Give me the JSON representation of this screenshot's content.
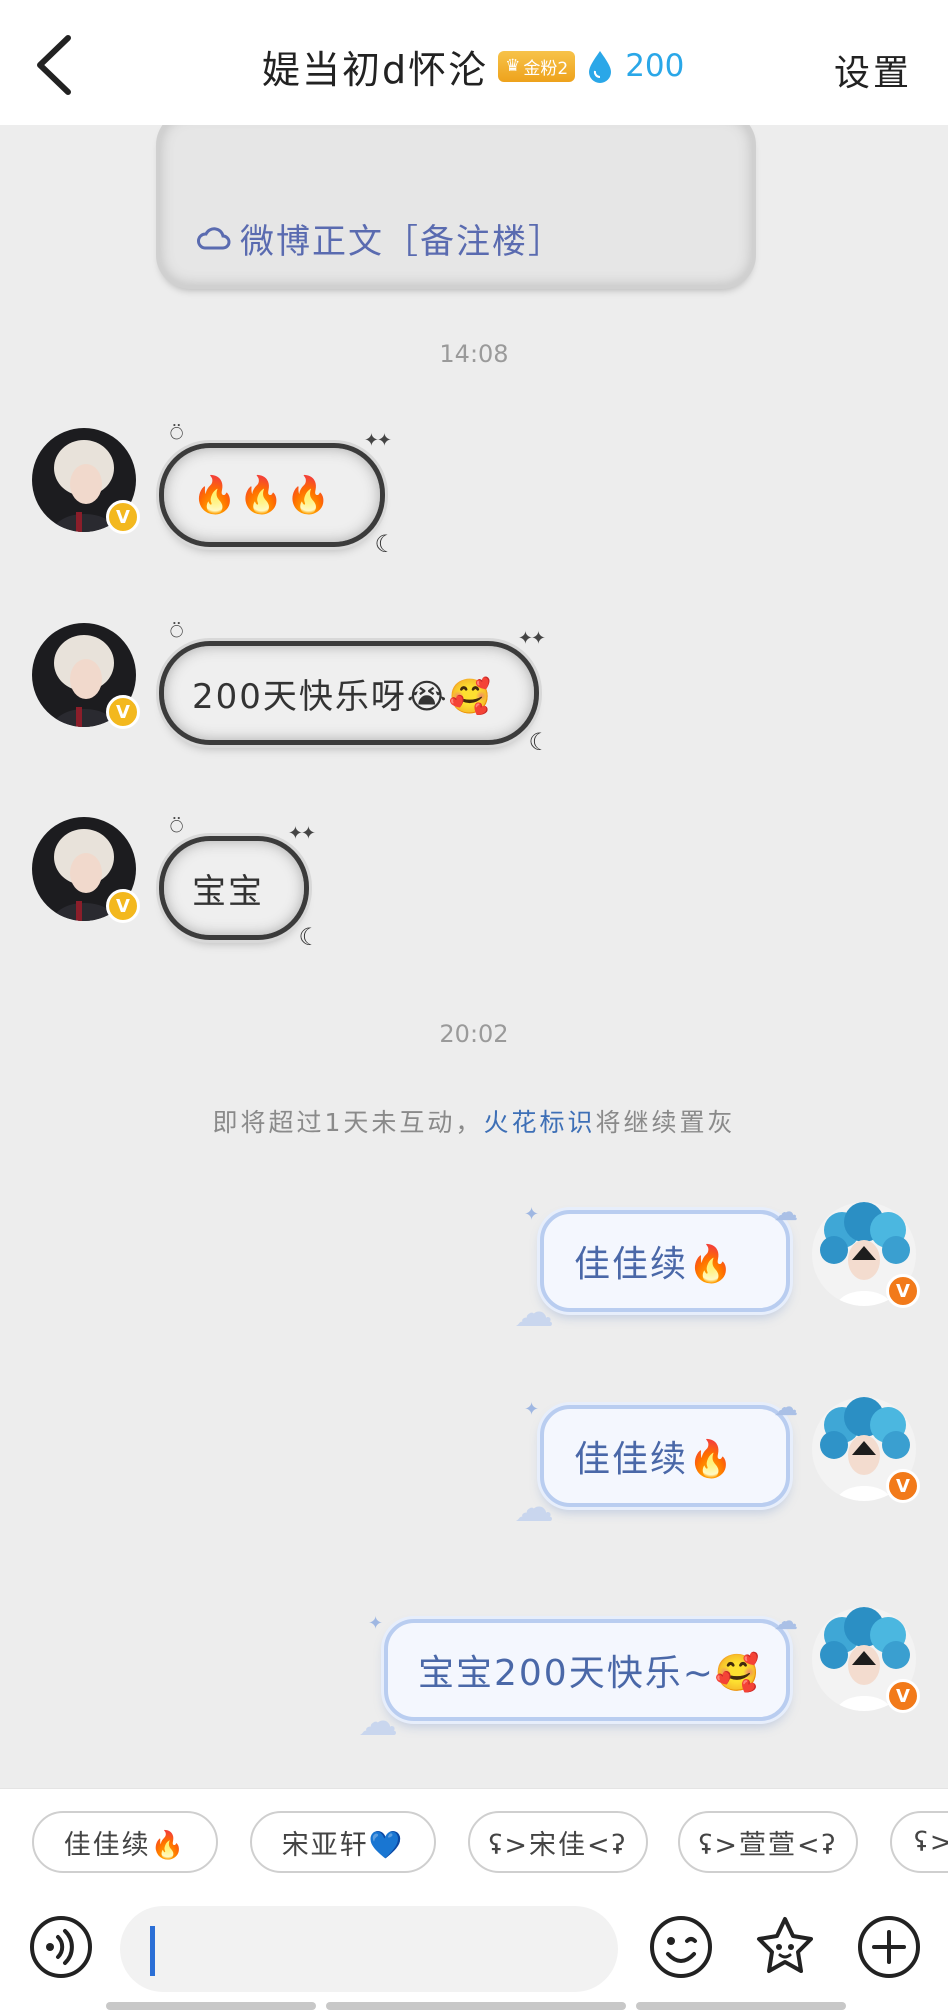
{
  "header": {
    "back_icon": "chevron-left-icon",
    "title": "媞当初d怀沦",
    "fan_badge": "金粉2",
    "spark_count": "200",
    "settings_label": "设置"
  },
  "chat": {
    "card_link_text": "微博正文［备注楼］",
    "timestamp_1": "14:08",
    "incoming": [
      {
        "text": "🔥🔥🔥"
      },
      {
        "text": "200天快乐呀😭🥰"
      },
      {
        "text": "宝宝"
      }
    ],
    "timestamp_2": "20:02",
    "system_note": {
      "before": "即将超过1天未互动，",
      "highlight": "火花标识",
      "after": "将继续置灰"
    },
    "outgoing": [
      {
        "text": "佳佳续🔥"
      },
      {
        "text": "佳佳续🔥"
      },
      {
        "text": "宝宝200天快乐~🥰"
      }
    ],
    "verified_badge": "V"
  },
  "quick_replies": [
    "佳佳续🔥",
    "宋亚轩💙",
    "ʢ>宋佳<ʡ",
    "ʢ>萱萱<ʡ",
    "ʢ>"
  ],
  "input_bar": {
    "voice_icon": "voice-icon",
    "emoji_icon": "smiley-icon",
    "sticker_icon": "star-sticker-icon",
    "plus_icon": "plus-icon"
  },
  "colors": {
    "spark_blue": "#2aa7e8",
    "link_blue": "#3d6fb6",
    "gold_badge": "#f3b81e",
    "orange_badge": "#f27a1a",
    "caret": "#2b6fd6"
  }
}
